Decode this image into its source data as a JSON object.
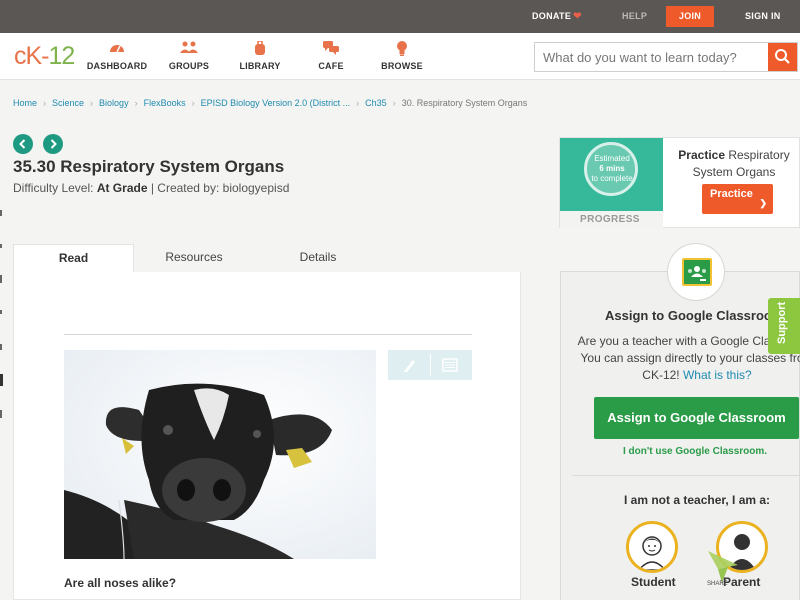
{
  "topbar": {
    "donate": "DONATE",
    "help": "HELP",
    "join": "JOIN",
    "sign_in": "SIGN IN"
  },
  "header": {
    "logo_left": "cK-",
    "logo_right": "12",
    "nav": [
      {
        "label": "DASHBOARD",
        "icon": "speedometer-icon"
      },
      {
        "label": "GROUPS",
        "icon": "people-icon"
      },
      {
        "label": "LIBRARY",
        "icon": "backpack-icon"
      },
      {
        "label": "CAFE",
        "icon": "chat-bubbles-icon"
      },
      {
        "label": "BROWSE",
        "icon": "lightbulb-icon"
      }
    ],
    "search_placeholder": "What do you want to learn today?"
  },
  "breadcrumb": [
    "Home",
    "Science",
    "Biology",
    "FlexBooks",
    "EPISD Biology Version 2.0 (District ...",
    "Ch35",
    "30. Respiratory System Organs"
  ],
  "lesson": {
    "title": "35.30 Respiratory System Organs",
    "difficulty_prefix": "Difficulty Level: ",
    "difficulty_level": "At Grade",
    "created_by": " | Created by: biologyepisd"
  },
  "tabs": [
    "Read",
    "Resources",
    "Details"
  ],
  "content": {
    "question": "Are all noses alike?"
  },
  "practice": {
    "estimated_line1": "Estimated",
    "estimated_line2": "6 mins",
    "estimated_line3": "to complete",
    "progress_label": "PROGRESS",
    "title_bold": "Practice",
    "title_rest": " Respiratory System Organs",
    "button": "Practice"
  },
  "google_classroom": {
    "title": "Assign to Google Classroom",
    "desc": "Are you a teacher with a Google Classroom? You can assign directly to your classes from CK-12! ",
    "what_link": "What is this?",
    "button": "Assign to Google Classroom",
    "no_link": "I don't use Google Classroom.",
    "not_teacher": "I am not a teacher, I am a:",
    "student": "Student",
    "parent": "Parent"
  },
  "support": "Support",
  "share": "SHARE",
  "colors": {
    "brand_orange": "#ef5a2a",
    "teal": "#1e9a83",
    "classroom_green": "#2a9b47",
    "link_blue": "#1f8bb0"
  }
}
